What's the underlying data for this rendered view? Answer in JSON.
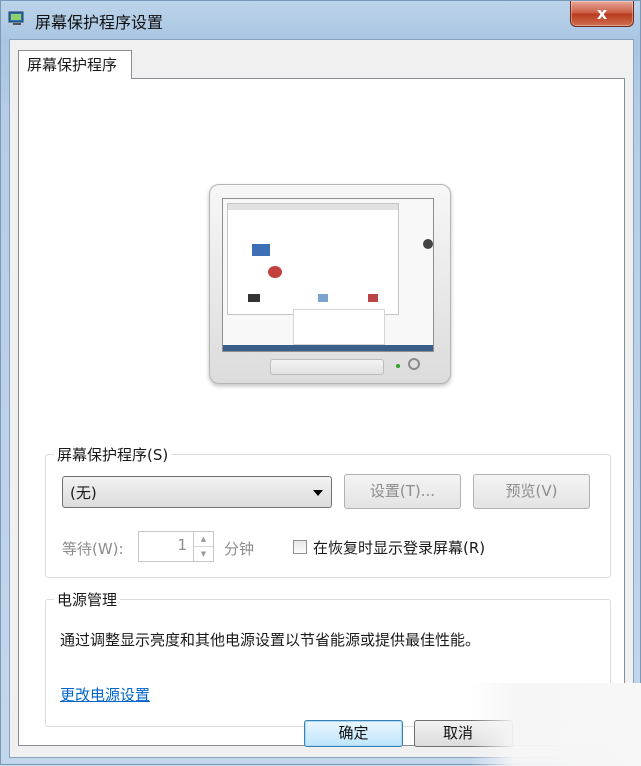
{
  "window": {
    "title": "屏幕保护程序设置",
    "close_label": "x"
  },
  "tab": {
    "label": "屏幕保护程序"
  },
  "screensaver": {
    "group_label": "屏幕保护程序(S)",
    "selected": "(无)",
    "settings_label": "设置(T)...",
    "preview_label": "预览(V)",
    "wait_label": "等待(W):",
    "wait_value": "1",
    "minutes_label": "分钟",
    "resume_label": "在恢复时显示登录屏幕(R)"
  },
  "power": {
    "group_label": "电源管理",
    "description": "通过调整显示亮度和其他电源设置以节省能源或提供最佳性能。",
    "link": "更改电源设置"
  },
  "buttons": {
    "ok": "确定",
    "cancel": "取消"
  },
  "colors": {
    "link": "#0066cc",
    "close": "#c95a3f",
    "disabled_text": "#8d8d8d"
  }
}
